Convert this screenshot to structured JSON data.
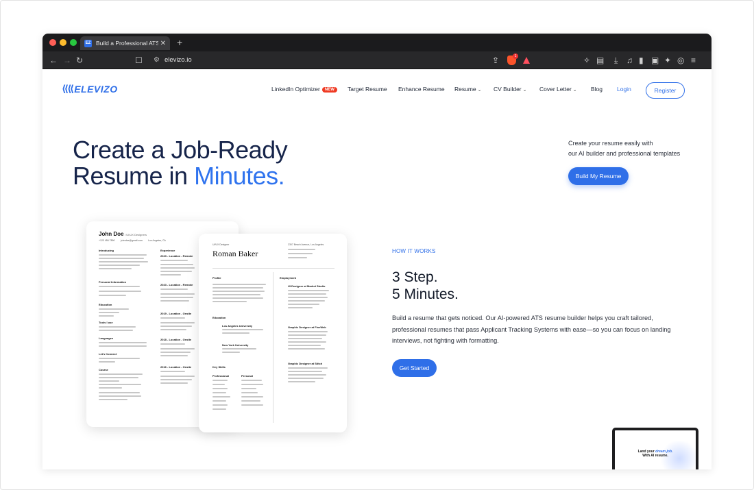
{
  "browser": {
    "tab_title": "Build a Professional ATS-Frien",
    "tab_favicon": "EZ",
    "url": "elevizo.io",
    "brave_badge": "1",
    "icons": [
      "back-arrow",
      "forward-arrow",
      "reload",
      "bookmark",
      "site-settings",
      "share",
      "brave-shields",
      "brave-rewards",
      "extensions",
      "reader-mode",
      "downloads",
      "playlist",
      "sidebar",
      "wallet",
      "leo-ai",
      "vpn",
      "menu"
    ]
  },
  "nav": {
    "logo": "ELEVIZO",
    "items": [
      {
        "label": "LinkedIn Optimizer",
        "badge": "NEW"
      },
      {
        "label": "Target Resume"
      },
      {
        "label": "Enhance Resume"
      },
      {
        "label": "Resume"
      },
      {
        "label": "CV Builder"
      },
      {
        "label": "Cover Letter"
      },
      {
        "label": "Blog"
      }
    ],
    "login": "Login",
    "register": "Register"
  },
  "hero": {
    "title_line1": "Create a Job-Ready",
    "title_line2_prefix": "Resume in ",
    "title_line2_accent": "Minutes.",
    "subtitle_line1": "Create your resume easily with",
    "subtitle_line2": "our AI builder and professional templates",
    "cta": "Build My Resume"
  },
  "resume1": {
    "name": "John Doe",
    "role": "/ UI/UX Designers",
    "contact": [
      "+123 456 7890",
      "johndoe@gmail.com",
      "Los Angeles, CA"
    ],
    "left_sections": [
      "Introducing",
      "Personal Information",
      "Education",
      "Tools I use",
      "Languages",
      "Let's Connect",
      "Course"
    ],
    "right_heading": "Experience",
    "right_sections": [
      "2023 - Location - Remote",
      "2023 - Location - Remote",
      "2019 - Location - Onsite",
      "2018 - Location - Onsite",
      "2016 - Location - Onsite"
    ]
  },
  "resume2": {
    "label": "UI/UX Designer",
    "name": "Roman Baker",
    "address": "2307 Beach Avenue, Los Angeles",
    "sections": [
      "Profile",
      "Education",
      "Key Skills",
      "Employment"
    ],
    "education": [
      "Los Angeles University",
      "New York University"
    ],
    "skills_professional": "Professional",
    "skills_personal": "Personal",
    "jobs": [
      "UI Designer at Market Studio",
      "Graphic Designer at FineWeb",
      "Graphic Designer at Stitch"
    ]
  },
  "how": {
    "label": "HOW IT WORKS",
    "title_line1": "3 Step.",
    "title_line2": "5 Minutes.",
    "body": "Build a resume that gets noticed. Our AI-powered ATS resume builder helps you craft tailored, professional resumes that pass Applicant Tracking Systems with ease—so you can focus on landing interviews, not fighting with formatting.",
    "cta": "Get Started"
  },
  "laptop": {
    "line1_prefix": "Land your ",
    "line1_accent": "dream job.",
    "line2": "With AI resume."
  }
}
